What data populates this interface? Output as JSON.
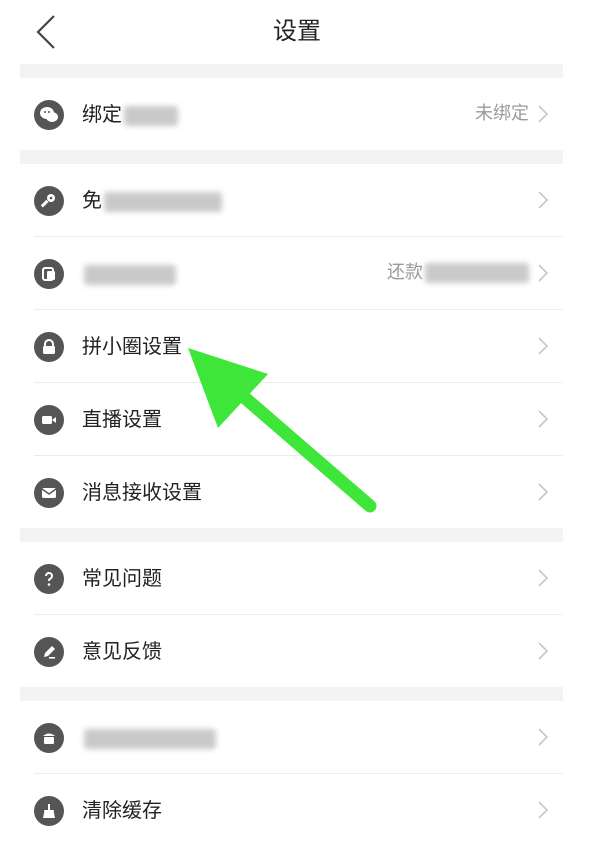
{
  "header": {
    "title": "设置",
    "back_icon": "chevron-left-icon"
  },
  "rows": [
    {
      "id": "bind-wechat",
      "label": "绑定",
      "value": "未绑定",
      "icon": "wechat-icon",
      "blurred_label": true
    },
    {
      "id": "pay-settings",
      "label": "免",
      "value": "",
      "icon": "key-icon",
      "blurred_label": true
    },
    {
      "id": "deduction-settings",
      "label": "",
      "value": "还款",
      "icon": "card-icon",
      "blurred_label": true,
      "blurred_value": true
    },
    {
      "id": "circle-settings",
      "label": "拼小圈设置",
      "value": "",
      "icon": "lock-icon"
    },
    {
      "id": "live-settings",
      "label": "直播设置",
      "value": "",
      "icon": "video-icon"
    },
    {
      "id": "message-settings",
      "label": "消息接收设置",
      "value": "",
      "icon": "mail-icon"
    },
    {
      "id": "faq",
      "label": "常见问题",
      "value": "",
      "icon": "question-icon"
    },
    {
      "id": "feedback",
      "label": "意见反馈",
      "value": "",
      "icon": "edit-icon"
    },
    {
      "id": "merchant-entry",
      "label": "",
      "value": "",
      "icon": "store-icon",
      "blurred_label": true
    },
    {
      "id": "clear-cache",
      "label": "清除缓存",
      "value": "",
      "icon": "broom-icon"
    }
  ],
  "colors": {
    "icon": "#555555",
    "arrow": "#3ee63a",
    "divider": "#ececec",
    "section_gap": "#f3f3f3"
  }
}
